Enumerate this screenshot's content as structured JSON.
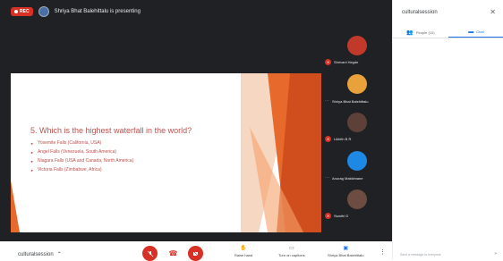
{
  "topbar": {
    "rec_label": "REC",
    "presenting_text": "Shriya Bhat Balehittalu is presenting"
  },
  "slide": {
    "title": "5. Which is the highest waterfall in the world?",
    "bullets": [
      "Yosemite Falls (California, USA)",
      "Angel Falls (Venezuela, South America)",
      "Niagara Falls (USA and Canada, North America)",
      "Victoria Falls (Zimbabwe, Africa)"
    ]
  },
  "participants": [
    {
      "name": "Shrivani Hegde",
      "muted": true,
      "avatar_color": "#c0392b"
    },
    {
      "name": "Shriya Bhat Balehittalu",
      "muted": false,
      "avatar_color": "#e9a23b"
    },
    {
      "name": "Likhith B R",
      "muted": true,
      "avatar_color": "#5d4037"
    },
    {
      "name": "Anurag Makkimane",
      "muted": false,
      "avatar_color": "#1e88e5"
    },
    {
      "name": "Swathi G",
      "muted": true,
      "avatar_color": "#6d4c41"
    }
  ],
  "bottombar": {
    "meeting_name": "culturalsession",
    "raise_hand": "Raise hand",
    "captions": "Turn on captions",
    "presenter": "Shriya Bhat Balehittalu"
  },
  "panel": {
    "title": "culturalsession",
    "people_tab": "People (10)",
    "chat_tab": "Chat",
    "input_placeholder": "Send a message to everyone"
  },
  "colors": {
    "accent": "#1a73e8",
    "danger": "#d93025",
    "slide_text": "#c0504d"
  },
  "icons": [
    "close-icon",
    "people-icon",
    "chat-icon",
    "mic-off-icon",
    "hangup-icon",
    "camera-off-icon",
    "raise-hand-icon",
    "captions-icon",
    "present-icon",
    "more-icon",
    "send-icon",
    "chevron-up-icon"
  ]
}
